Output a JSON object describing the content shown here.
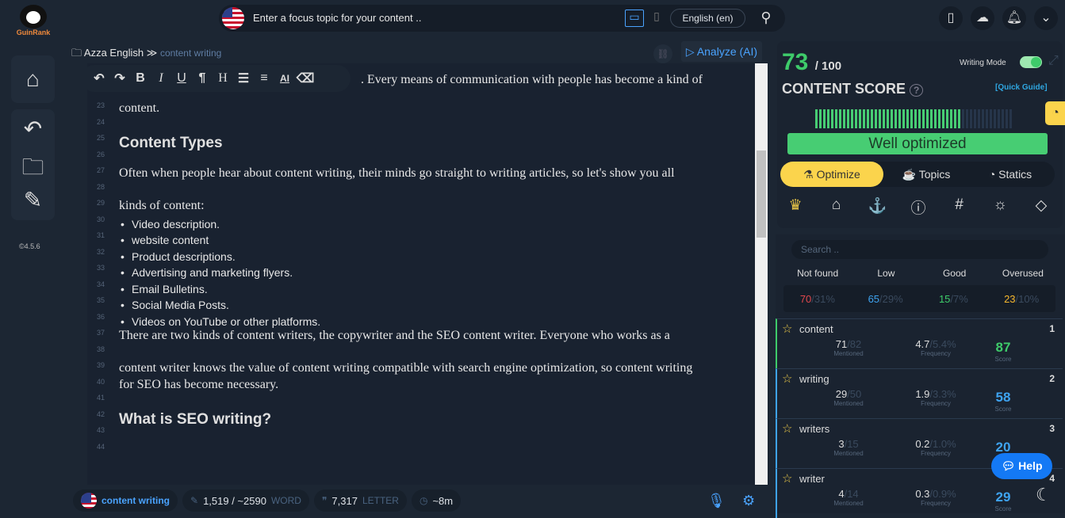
{
  "app": {
    "logo_text": "GuinRank",
    "version": "©4.5.6"
  },
  "topbar": {
    "focus_placeholder": "Enter a focus topic for your content ..",
    "language": "English (en)"
  },
  "breadcrumb": {
    "project": "Azza English",
    "separator": "≫",
    "document": "content writing"
  },
  "editor": {
    "analyze_label": "Analyze (AI)",
    "toolbar": [
      "undo",
      "redo",
      "B",
      "I",
      "U",
      "¶",
      "H",
      "list",
      "align",
      "AI",
      "eraser"
    ],
    "lines": [
      {
        "n": "23",
        "text": "content.",
        "type": "p"
      },
      {
        "n": "24",
        "text": "",
        "type": "p"
      },
      {
        "n": "25",
        "text": "Content Types",
        "type": "h"
      },
      {
        "n": "26",
        "text": "",
        "type": "p"
      },
      {
        "n": "27",
        "text": "Often when people hear about content writing, their minds go straight to writing articles, so let's show you all",
        "type": "p"
      },
      {
        "n": "28",
        "text": "",
        "type": "p"
      },
      {
        "n": "29",
        "text": "kinds of content:",
        "type": "p"
      },
      {
        "n": "30",
        "text": "Video description.",
        "type": "li"
      },
      {
        "n": "31",
        "text": "website content",
        "type": "li"
      },
      {
        "n": "32",
        "text": "Product descriptions.",
        "type": "li"
      },
      {
        "n": "33",
        "text": "Advertising and marketing flyers.",
        "type": "li"
      },
      {
        "n": "34",
        "text": "Email Bulletins.",
        "type": "li"
      },
      {
        "n": "35",
        "text": "Social Media Posts.",
        "type": "li"
      },
      {
        "n": "36",
        "text": "Videos on YouTube or other platforms.",
        "type": "li"
      },
      {
        "n": "37",
        "text": "There are two kinds of content writers, the copywriter and the SEO content writer. Everyone who works as a",
        "type": "p"
      },
      {
        "n": "38",
        "text": "",
        "type": "p"
      },
      {
        "n": "39",
        "text": "content writer knows the value of content writing compatible with search engine optimization, so content writing",
        "type": "p"
      },
      {
        "n": "40",
        "text": "for SEO has become necessary.",
        "type": "p"
      },
      {
        "n": "41",
        "text": "",
        "type": "p"
      },
      {
        "n": "42",
        "text": "What is SEO writing?",
        "type": "h"
      },
      {
        "n": "43",
        "text": "",
        "type": "p"
      },
      {
        "n": "44",
        "text": "",
        "type": "p"
      }
    ],
    "first_line_partial": ". Every means of communication with people has become a kind of"
  },
  "status": {
    "keyword": "content writing",
    "words": "1,519 / ~2590",
    "words_label": "WORD",
    "letters": "7,317",
    "letters_label": "LETTER",
    "time": "~8m"
  },
  "score_panel": {
    "score": "73",
    "max": "/ 100",
    "title": "CONTENT SCORE",
    "writing_mode": "Writing Mode",
    "writing_mode_on": true,
    "quick_guide": "[Quick Guide]",
    "score_percent": 73,
    "status": "Well optimized",
    "tabs": [
      "Optimize",
      "Topics",
      "Statics"
    ],
    "active_tab": "Optimize",
    "icons": [
      "crown-icon",
      "tag-icon",
      "anchor-icon",
      "question-icon",
      "grid-icon",
      "lightbulb-icon",
      "diamond-icon"
    ]
  },
  "keywords": {
    "search_placeholder": "Search ..",
    "categories": [
      {
        "label": "Not found",
        "count": "70",
        "pct": "/31%",
        "color": "#e0474c"
      },
      {
        "label": "Low",
        "count": "65",
        "pct": "/29%",
        "color": "#3ea3f0"
      },
      {
        "label": "Good",
        "count": "15",
        "pct": "/7%",
        "color": "#3ecb6a"
      },
      {
        "label": "Overused",
        "count": "23",
        "pct": "/10%",
        "color": "#f5b82e"
      }
    ],
    "mentioned_label": "Mentioned",
    "frequency_label": "Frequency",
    "score_label": "Score",
    "items": [
      {
        "name": "content",
        "rank": "1",
        "mentioned": "71",
        "mentioned_target": "/82",
        "freq": "4.7",
        "freq_target": "/5.4%",
        "score": "87",
        "color": "#3ecb6a"
      },
      {
        "name": "writing",
        "rank": "2",
        "mentioned": "29",
        "mentioned_target": "/50",
        "freq": "1.9",
        "freq_target": "/3.3%",
        "score": "58",
        "color": "#3ea3f0"
      },
      {
        "name": "writers",
        "rank": "3",
        "mentioned": "3",
        "mentioned_target": "/15",
        "freq": "0.2",
        "freq_target": "/1.0%",
        "score": "20",
        "color": "#3ea3f0"
      },
      {
        "name": "writer",
        "rank": "4",
        "mentioned": "4",
        "mentioned_target": "/14",
        "freq": "0.3",
        "freq_target": "/0.9%",
        "score": "29",
        "color": "#3ea3f0"
      }
    ]
  },
  "help_label": "Help"
}
